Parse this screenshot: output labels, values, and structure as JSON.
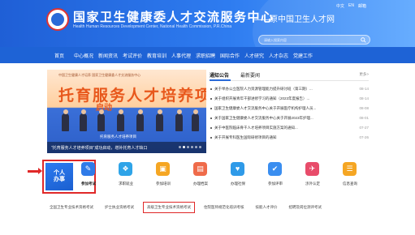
{
  "header": {
    "title_cn": "国家卫生健康委人才交流服务中心",
    "title_en": "Health Human Resources Development Center, National Health Commission, P.R.China",
    "former_name": "——原中国卫生人才网",
    "lang_links": [
      "中文",
      "EN",
      "邮箱"
    ],
    "search_placeholder": "请输入搜索内容",
    "brand_color": "#1f5fd6"
  },
  "nav": {
    "items": [
      "首页",
      "中心概况",
      "新闻资讯",
      "考试评价",
      "教育培训",
      "人事代理",
      "求职招聘",
      "国际合作",
      "人才研究",
      "人才杂志",
      "党建工作"
    ]
  },
  "banner": {
    "top_text": "中国卫生健康人才培养 国家卫生健康委人才交流服务中心",
    "headline": "托育服务人才培养项",
    "sub": "启动",
    "screen_label": "托育服务人才培养项目",
    "caption": "“托育服务人才培养项目”成功启动，增补托育人才缺口",
    "slide_count": 6,
    "active_slide": 1
  },
  "news": {
    "tabs": [
      "通知公告",
      "最新要闻"
    ],
    "more": "更多>",
    "items": [
      {
        "title": "关于举办公立医院人力资源管理能力提升研讨班（第三期）...",
        "date": "08-14"
      },
      {
        "title": "关于组织开展青年干部进修学习的通知（2023年度报告）...",
        "date": "08-14"
      },
      {
        "title": "国家卫生健康委人才交流服务中心关于开展医疗机构护理人员...",
        "date": "08-08"
      },
      {
        "title": "关于国家卫生健康委人才交流服务中心关于开展2023年护理...",
        "date": "08-01"
      },
      {
        "title": "关于中医院临床骨干人才培养项目实施方案的通知...",
        "date": "07-27"
      },
      {
        "title": "关于开展专科医生国际研修项目的通知",
        "date": "07-26"
      }
    ]
  },
  "services": {
    "personal_label": "个人办事",
    "items": [
      {
        "label": "参加考试",
        "icon": "exam-icon",
        "glyph": "✎",
        "color": "#2f7be8"
      },
      {
        "label": "求职就业",
        "icon": "job-icon",
        "glyph": "❖",
        "color": "#2fa4e8"
      },
      {
        "label": "参加培训",
        "icon": "training-icon",
        "glyph": "▣",
        "color": "#f5a623"
      },
      {
        "label": "办理档案",
        "icon": "archive-icon",
        "glyph": "▤",
        "color": "#ef6b4a"
      },
      {
        "label": "办理社保",
        "icon": "insurance-icon",
        "glyph": "♥",
        "color": "#2f9ae8"
      },
      {
        "label": "参加评审",
        "icon": "review-icon",
        "glyph": "✔",
        "color": "#3a8ef0"
      },
      {
        "label": "涉外认定",
        "icon": "foreign-icon",
        "glyph": "✈",
        "color": "#e84c6a"
      },
      {
        "label": "信息查询",
        "icon": "query-icon",
        "glyph": "☰",
        "color": "#f5a623"
      }
    ]
  },
  "quick_links": [
    {
      "label": "全国卫生专业技术资格考试",
      "boxed": false
    },
    {
      "label": "护士执业资格考试",
      "boxed": false
    },
    {
      "label": "高级卫生专业技术资格考试",
      "boxed": true
    },
    {
      "label": "住院医师规范化培训考核",
      "boxed": false
    },
    {
      "label": "技能人才评价",
      "boxed": false
    },
    {
      "label": "招聘及岗位测评考试",
      "boxed": false
    }
  ]
}
